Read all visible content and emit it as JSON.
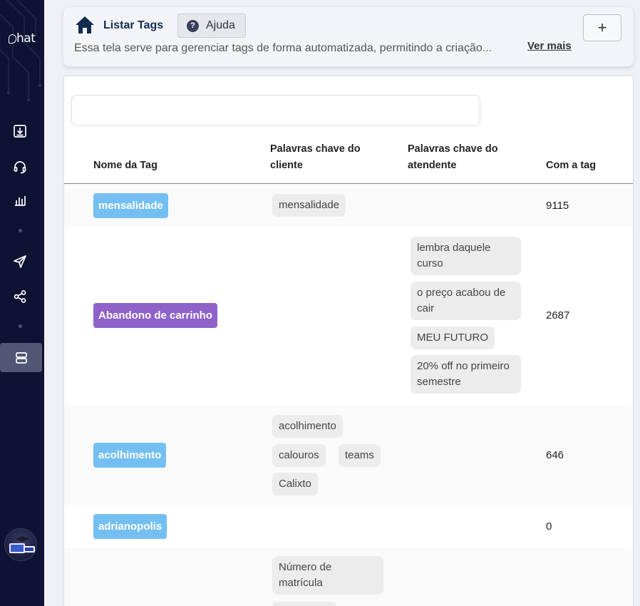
{
  "sidebar": {
    "logo_text": "hat",
    "logo_sub": "",
    "items": [
      {
        "icon": "download-tray-icon"
      },
      {
        "icon": "headset-icon"
      },
      {
        "icon": "bar-chart-icon"
      },
      {
        "icon": "send-icon"
      },
      {
        "icon": "share-nodes-icon"
      },
      {
        "icon": "server-stack-icon",
        "active": true
      }
    ]
  },
  "header": {
    "title": "Listar Tags",
    "help_label": "Ajuda",
    "description": "Essa tela serve para gerenciar tags de forma automatizada, permitindo a criação...",
    "ver_mais": "Ver mais",
    "add_label": "+"
  },
  "search": {
    "placeholder": ""
  },
  "table": {
    "headers": {
      "name": "Nome da Tag",
      "client_kw_line1": "Palavras chave do",
      "client_kw_line2": "cliente",
      "agent_kw_line1": "Palavras chave do",
      "agent_kw_line2": "atendente",
      "count": "Com a tag"
    },
    "rows": [
      {
        "tag": "mensalidade",
        "color": "#74bff2",
        "client_keywords": [
          "mensalidade"
        ],
        "agent_keywords": [],
        "count": "9115"
      },
      {
        "tag": "Abandono de carrinho",
        "color": "#8e62c9",
        "client_keywords": [],
        "agent_keywords": [
          "lembra daquele curso",
          "o preço acabou de cair",
          "MEU FUTURO",
          "20% off no primeiro semestre"
        ],
        "count": "2687"
      },
      {
        "tag": "acolhimento",
        "color": "#74bff2",
        "client_keywords": [
          "acolhimento",
          "calouros",
          "teams",
          "Calixto"
        ],
        "agent_keywords": [],
        "count": "646"
      },
      {
        "tag": "adrianopolis",
        "color": "#74bff2",
        "client_keywords": [],
        "agent_keywords": [],
        "count": "0"
      },
      {
        "tag": "",
        "color": "",
        "client_keywords": [
          "Número de matrícula"
        ],
        "agent_keywords": [],
        "count": ""
      }
    ]
  }
}
